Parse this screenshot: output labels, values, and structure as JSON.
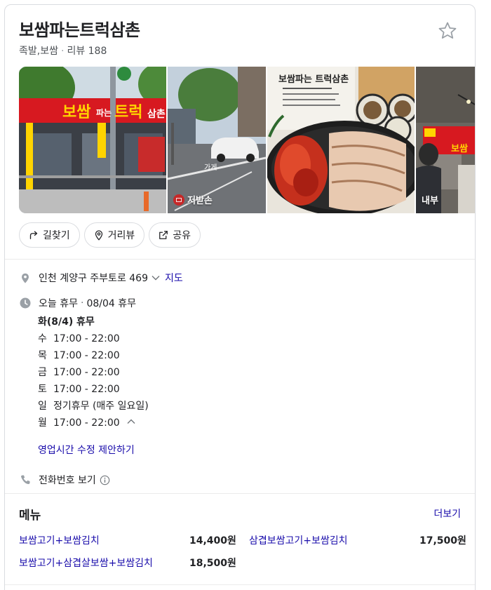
{
  "place": {
    "name": "보쌈파는트럭삼촌",
    "category": "족발,보쌈",
    "review_label": "리뷰 188"
  },
  "photos": {
    "sign_text_1": "보쌈",
    "sign_text_2": "파는",
    "sign_text_3": "트럭",
    "sign_text_4": "삼촌",
    "tag_store": "가게",
    "tag_uploader": "저받손",
    "tag_interior": "내부",
    "menu_card_text": "보쌈파는 트럭삼촌",
    "interior_sign": "보쌈"
  },
  "actions": {
    "directions": "길찾기",
    "streetview": "거리뷰",
    "share": "공유"
  },
  "address": {
    "text": "인천 계양구 주부토로 469",
    "map_link": "지도"
  },
  "hours": {
    "status": "오늘 휴무",
    "status_detail": "08/04 휴무",
    "rows": [
      {
        "day": "화(8/4)",
        "time": "휴무"
      },
      {
        "day": "수",
        "time": "17:00 - 22:00"
      },
      {
        "day": "목",
        "time": "17:00 - 22:00"
      },
      {
        "day": "금",
        "time": "17:00 - 22:00"
      },
      {
        "day": "토",
        "time": "17:00 - 22:00"
      },
      {
        "day": "일",
        "time": "정기휴무 (매주 일요일)"
      },
      {
        "day": "월",
        "time": "17:00 - 22:00"
      }
    ],
    "suggest_edit": "영업시간 수정 제안하기"
  },
  "phone": {
    "label": "전화번호 보기"
  },
  "menu": {
    "title": "메뉴",
    "more": "더보기",
    "items": [
      {
        "name": "보쌈고기+보쌈김치",
        "price": "14,400원"
      },
      {
        "name": "삼겹보쌈고기+보쌈김치",
        "price": "17,500원"
      },
      {
        "name": "보쌈고기+삼겹살보쌈+보쌈김치",
        "price": "18,500원"
      }
    ]
  },
  "colors": {
    "link": "#1a0dab",
    "text": "#202124",
    "muted": "#70757a",
    "border": "#dadce0",
    "sign_red": "#d71920",
    "sign_yellow": "#ffd400"
  }
}
